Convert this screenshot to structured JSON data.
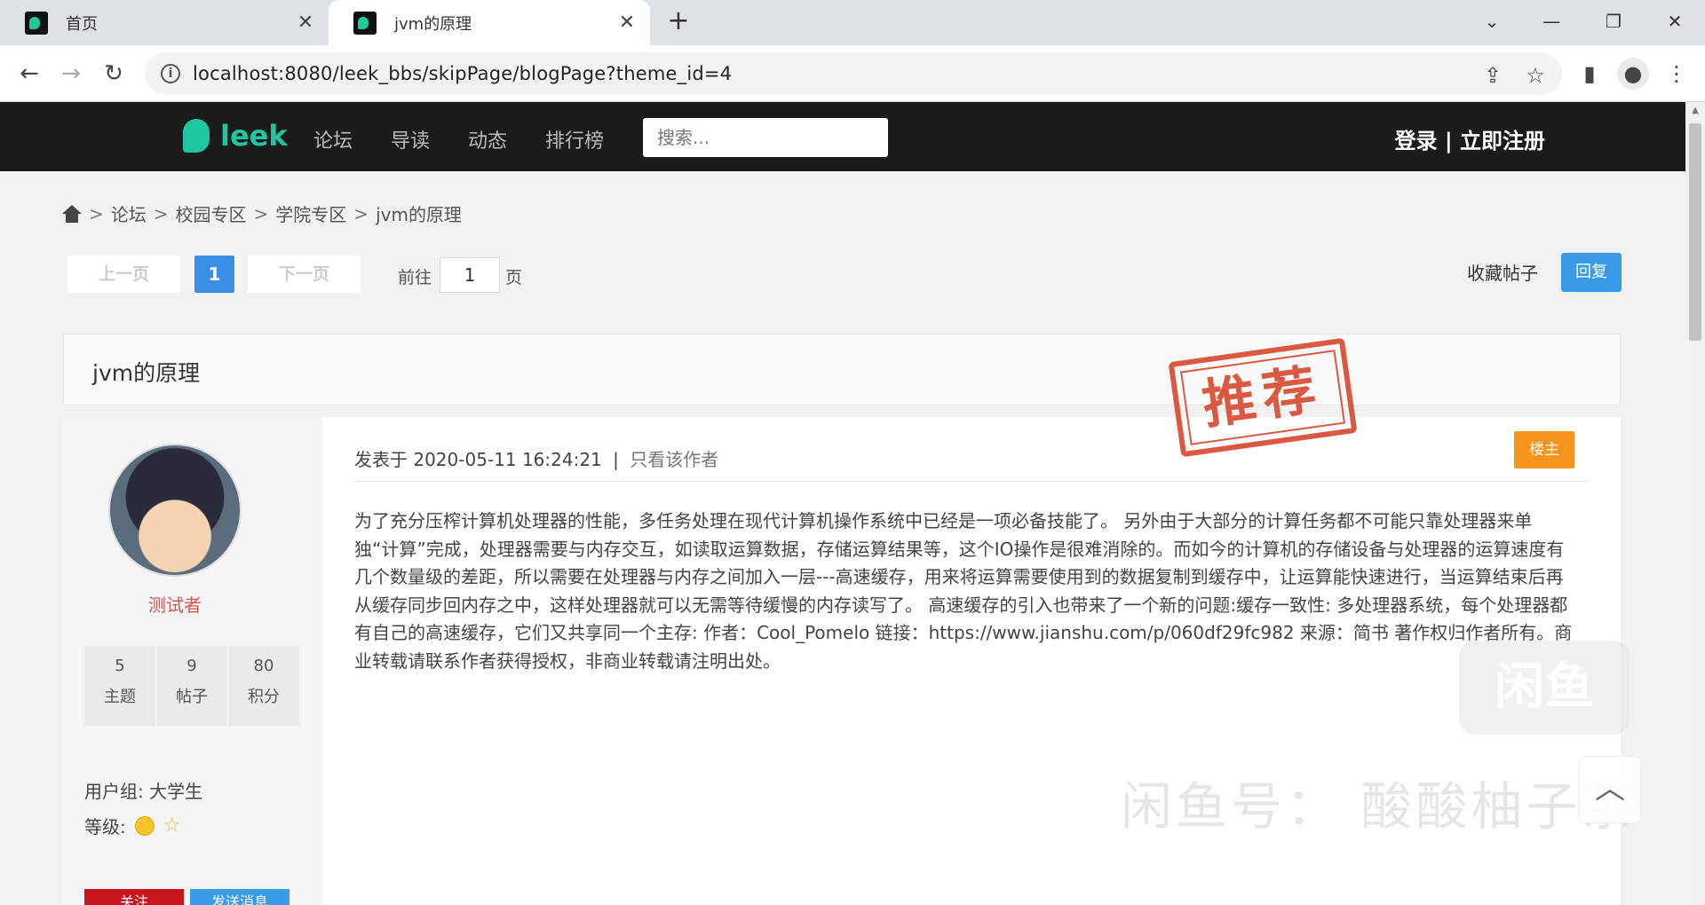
{
  "browser": {
    "tabs": [
      {
        "title": "首页",
        "active": false
      },
      {
        "title": "jvm的原理",
        "active": true
      }
    ],
    "new_tab": "+",
    "address": "localhost:8080/leek_bbs/skipPage/blogPage?theme_id=4"
  },
  "site": {
    "logo_text": "leek",
    "nav": [
      "论坛",
      "导读",
      "动态",
      "排行榜"
    ],
    "search_placeholder": "搜索...",
    "auth_text": "登录 |  立即注册"
  },
  "breadcrumb": {
    "items": [
      "论坛",
      "校园专区",
      "学院专区",
      "jvm的原理"
    ],
    "separator": ">"
  },
  "pagination": {
    "prev": "上一页",
    "current": "1",
    "next": "下一页",
    "goto_prefix": "前往",
    "goto_value": "1",
    "goto_suffix": "页"
  },
  "actions": {
    "favorite": "收藏帖子",
    "reply": "回复"
  },
  "post": {
    "title": "jvm的原理",
    "meta_prefix": "发表于",
    "date": "2020-05-11 16:24:21",
    "meta_sep": "|",
    "only_author": "只看该作者",
    "owner_badge": "楼主",
    "content": "为了充分压榨计算机处理器的性能，多任务处理在现代计算机操作系统中已经是一项必备技能了。 另外由于大部分的计算任务都不可能只靠处理器来单独“计算”完成，处理器需要与内存交互，如读取运算数据，存储运算结果等，这个IO操作是很难消除的。而如今的计算机的存储设备与处理器的运算速度有几个数量级的差距，所以需要在处理器与内存之间加入一层---高速缓存，用来将运算需要使用到的数据复制到缓存中，让运算能快速进行，当运算结束后再从缓存同步回内存之中，这样处理器就可以无需等待缓慢的内存读写了。 高速缓存的引入也带来了一个新的问题:缓存一致性: 多处理器系统，每个处理器都有自己的高速缓存，它们又共享同一个主存: 作者：Cool_Pomelo 链接：https://www.jianshu.com/p/060df29fc982 来源：简书 著作权归作者所有。商业转载请联系作者获得授权，非商业转载请注明出处。"
  },
  "author": {
    "name": "测试者",
    "stats": [
      {
        "value": "5",
        "label": "主题"
      },
      {
        "value": "9",
        "label": "帖子"
      },
      {
        "value": "80",
        "label": "积分"
      }
    ],
    "group_label": "用户组:",
    "group_value": "大学生",
    "level_label": "等级:",
    "follow": "关注",
    "message": "发送消息"
  },
  "overlays": {
    "stamp": "推荐",
    "watermark_logo": "闲鱼",
    "watermark_text": "闲鱼号：  酸酸柚子茶"
  },
  "colors": {
    "header_bg": "#1b1b1b",
    "brand": "#1fc7a0",
    "primary": "#3a9be8",
    "owner_badge": "#f7941d",
    "author_name": "#d9534f"
  }
}
